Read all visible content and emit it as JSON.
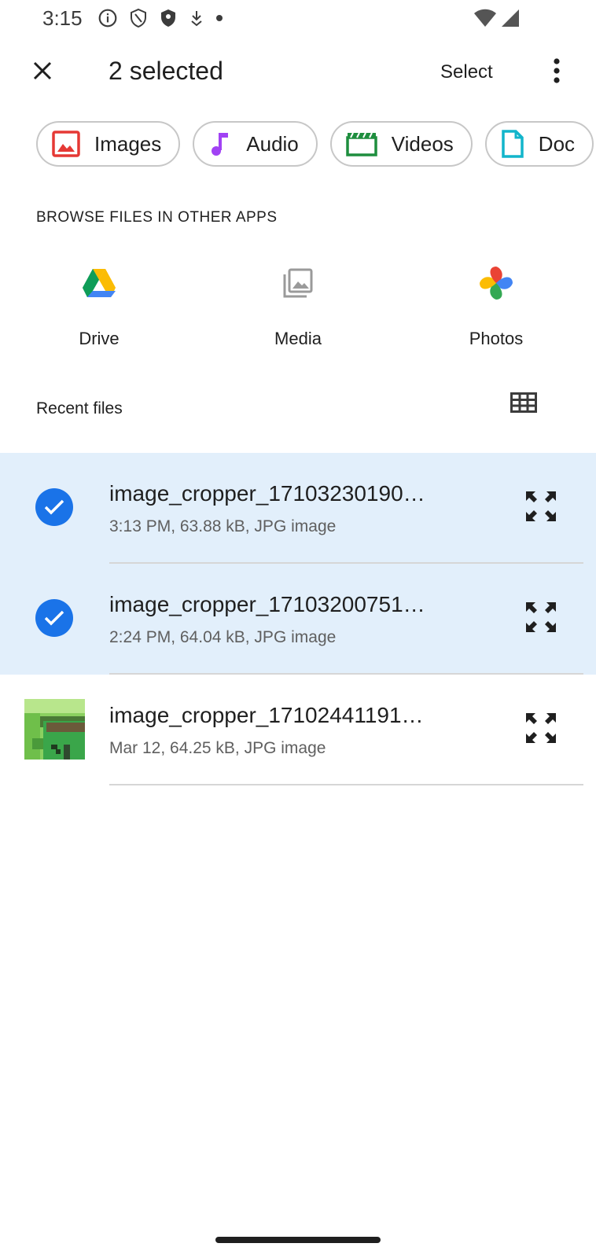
{
  "status_bar": {
    "time": "3:15"
  },
  "app_bar": {
    "title": "2 selected",
    "select_label": "Select"
  },
  "chips": [
    {
      "label": "Images",
      "icon": "image-icon",
      "color": "#e53935"
    },
    {
      "label": "Audio",
      "icon": "music-note-icon",
      "color": "#a142f4"
    },
    {
      "label": "Videos",
      "icon": "clapperboard-icon",
      "color": "#1e8e3e"
    },
    {
      "label": "Doc",
      "icon": "document-icon",
      "color": "#12b5cb"
    }
  ],
  "browse": {
    "header": "BROWSE FILES IN OTHER APPS",
    "apps": [
      {
        "label": "Drive",
        "icon": "google-drive-icon"
      },
      {
        "label": "Media",
        "icon": "media-gallery-icon"
      },
      {
        "label": "Photos",
        "icon": "google-photos-icon"
      }
    ]
  },
  "recent": {
    "header": "Recent files",
    "view_toggle_icon": "grid-view-icon",
    "files": [
      {
        "name": "image_cropper_17103230190…",
        "meta": "3:13 PM, 63.88 kB, JPG image",
        "selected": true
      },
      {
        "name": "image_cropper_17103200751…",
        "meta": "2:24 PM, 64.04 kB, JPG image",
        "selected": true
      },
      {
        "name": "image_cropper_17102441191…",
        "meta": "Mar 12, 64.25 kB, JPG image",
        "selected": false
      }
    ]
  },
  "colors": {
    "selected_row_bg": "#e2effb",
    "check_blue": "#1a73e8"
  }
}
